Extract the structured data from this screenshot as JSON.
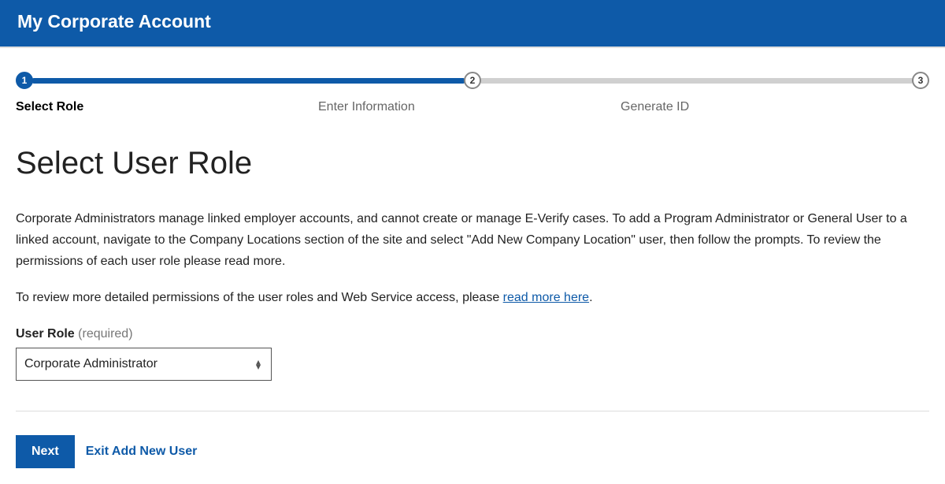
{
  "header": {
    "title": "My Corporate Account"
  },
  "stepper": {
    "steps": [
      {
        "num": "1",
        "label": "Select Role"
      },
      {
        "num": "2",
        "label": "Enter Information"
      },
      {
        "num": "3",
        "label": "Generate ID"
      }
    ]
  },
  "page": {
    "title": "Select User Role",
    "paragraph1": "Corporate Administrators manage linked employer accounts, and cannot create or manage E-Verify cases. To add a Program Administrator or General User to a linked account, navigate to the Company Locations section of the site and select \"Add New Company Location\" user, then follow the prompts. To review the permissions of each user role please read more.",
    "paragraph2_prefix": "To review more detailed permissions of the user roles and Web Service access, please ",
    "paragraph2_link": "read more here",
    "paragraph2_suffix": "."
  },
  "form": {
    "user_role_label": "User Role",
    "required_text": "(required)",
    "user_role_value": "Corporate Administrator"
  },
  "actions": {
    "next": "Next",
    "exit": "Exit Add New User"
  }
}
